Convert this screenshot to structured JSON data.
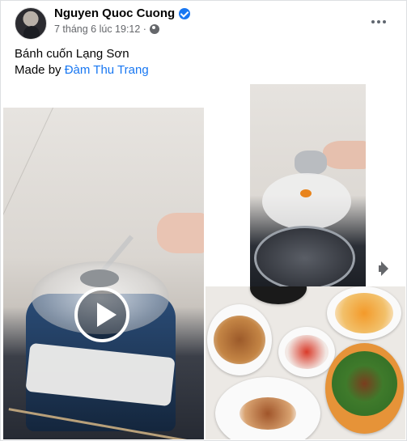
{
  "post": {
    "author": "Nguyen Quoc Cuong",
    "timestamp": "7 tháng 6 lúc 19:12 ·",
    "caption_line1": "Bánh cuốn Lạng Sơn",
    "caption_prefix": "Made by",
    "caption_link": "Đàm Thu Trang"
  },
  "icons": {
    "verified": "verified-badge-icon",
    "privacy": "globe-icon",
    "menu": "more-options-icon",
    "play": "play-icon",
    "mute": "speaker-icon"
  },
  "colors": {
    "link": "#1877f2",
    "verified": "#1877f2",
    "meta_text": "#65676b"
  }
}
